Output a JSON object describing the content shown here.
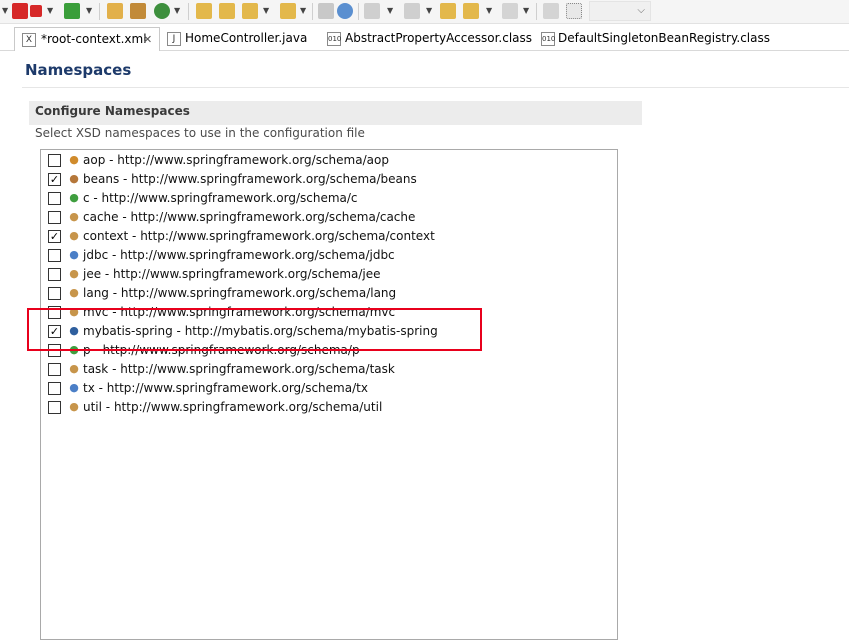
{
  "toolbar": {
    "icons": [
      "stop-icon",
      "run-icon",
      "open-type-icon",
      "build-icon",
      "refresh-icon",
      "open-folder-icon",
      "edit-icon",
      "tool-icon",
      "globe-icon",
      "download-icon",
      "pin-icon",
      "back-icon",
      "forward-icon",
      "grid-icon"
    ],
    "combo_value": ""
  },
  "tabs": [
    {
      "label": "*root-context.xml",
      "icon": "xml-editor-icon",
      "active": true
    },
    {
      "label": "HomeController.java",
      "icon": "java-file-icon",
      "active": false
    },
    {
      "label": "AbstractPropertyAccessor.class",
      "icon": "class-file-icon",
      "active": false
    },
    {
      "label": "DefaultSingletonBeanRegistry.class",
      "icon": "class-file-icon",
      "active": false
    }
  ],
  "editor": {
    "title": "Namespaces",
    "section_title": "Configure Namespaces",
    "section_desc": "Select XSD namespaces to use in the configuration file"
  },
  "namespaces": [
    {
      "label": "aop - http://www.springframework.org/schema/aop",
      "checked": false,
      "icon_color": "#d08b2c"
    },
    {
      "label": "beans - http://www.springframework.org/schema/beans",
      "checked": true,
      "icon_color": "#b5773a"
    },
    {
      "label": "c - http://www.springframework.org/schema/c",
      "checked": false,
      "icon_color": "#3f9e3f"
    },
    {
      "label": "cache - http://www.springframework.org/schema/cache",
      "checked": false,
      "icon_color": "#c7954b"
    },
    {
      "label": "context - http://www.springframework.org/schema/context",
      "checked": true,
      "icon_color": "#c7954b"
    },
    {
      "label": "jdbc - http://www.springframework.org/schema/jdbc",
      "checked": false,
      "icon_color": "#4b7fc7"
    },
    {
      "label": "jee - http://www.springframework.org/schema/jee",
      "checked": false,
      "icon_color": "#c7954b"
    },
    {
      "label": "lang - http://www.springframework.org/schema/lang",
      "checked": false,
      "icon_color": "#c7954b"
    },
    {
      "label": "mvc - http://www.springframework.org/schema/mvc",
      "checked": false,
      "icon_color": "#c7954b"
    },
    {
      "label": "mybatis-spring - http://mybatis.org/schema/mybatis-spring",
      "checked": true,
      "icon_color": "#2f5f9e"
    },
    {
      "label": "p - http://www.springframework.org/schema/p",
      "checked": false,
      "icon_color": "#3f9e3f"
    },
    {
      "label": "task - http://www.springframework.org/schema/task",
      "checked": false,
      "icon_color": "#c7954b"
    },
    {
      "label": "tx - http://www.springframework.org/schema/tx",
      "checked": false,
      "icon_color": "#4b7fc7"
    },
    {
      "label": "util - http://www.springframework.org/schema/util",
      "checked": false,
      "icon_color": "#c7954b"
    }
  ],
  "highlight_color": "#e8001c"
}
